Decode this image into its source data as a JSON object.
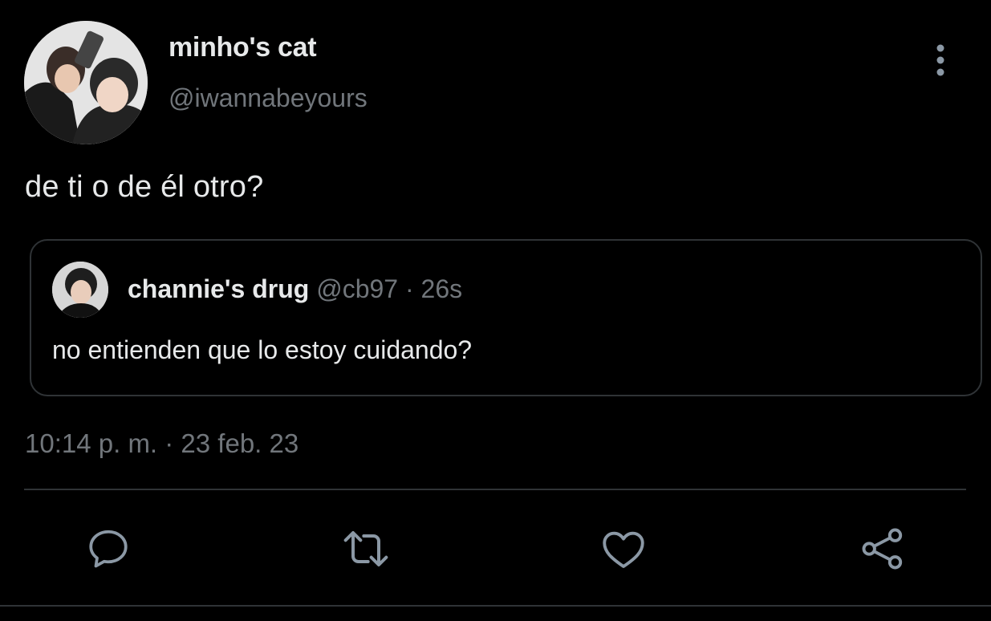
{
  "author": {
    "display_name": "minho's cat",
    "handle": "@iwannabeyours",
    "avatar_icon": "profile-photo"
  },
  "tweet": {
    "text": "de ti o de él otro?",
    "timestamp": "10:14 p. m. · 23 feb. 23"
  },
  "quoted_tweet": {
    "display_name": "channie's drug",
    "handle": "@cb97",
    "separator": "·",
    "age": "26s",
    "text": "no entienden que lo estoy cuidando?",
    "avatar_icon": "profile-photo"
  },
  "menu": {
    "icon": "more-vertical-icon"
  },
  "actions": [
    {
      "name": "reply",
      "icon": "speech-bubble-icon"
    },
    {
      "name": "retweet",
      "icon": "retweet-arrows-icon"
    },
    {
      "name": "like",
      "icon": "heart-icon"
    },
    {
      "name": "share",
      "icon": "share-nodes-icon"
    }
  ],
  "colors": {
    "background": "#000000",
    "primary_text": "#e7e9ea",
    "secondary_text": "#71767b",
    "border": "#2f3336",
    "icon": "#8b98a5"
  }
}
